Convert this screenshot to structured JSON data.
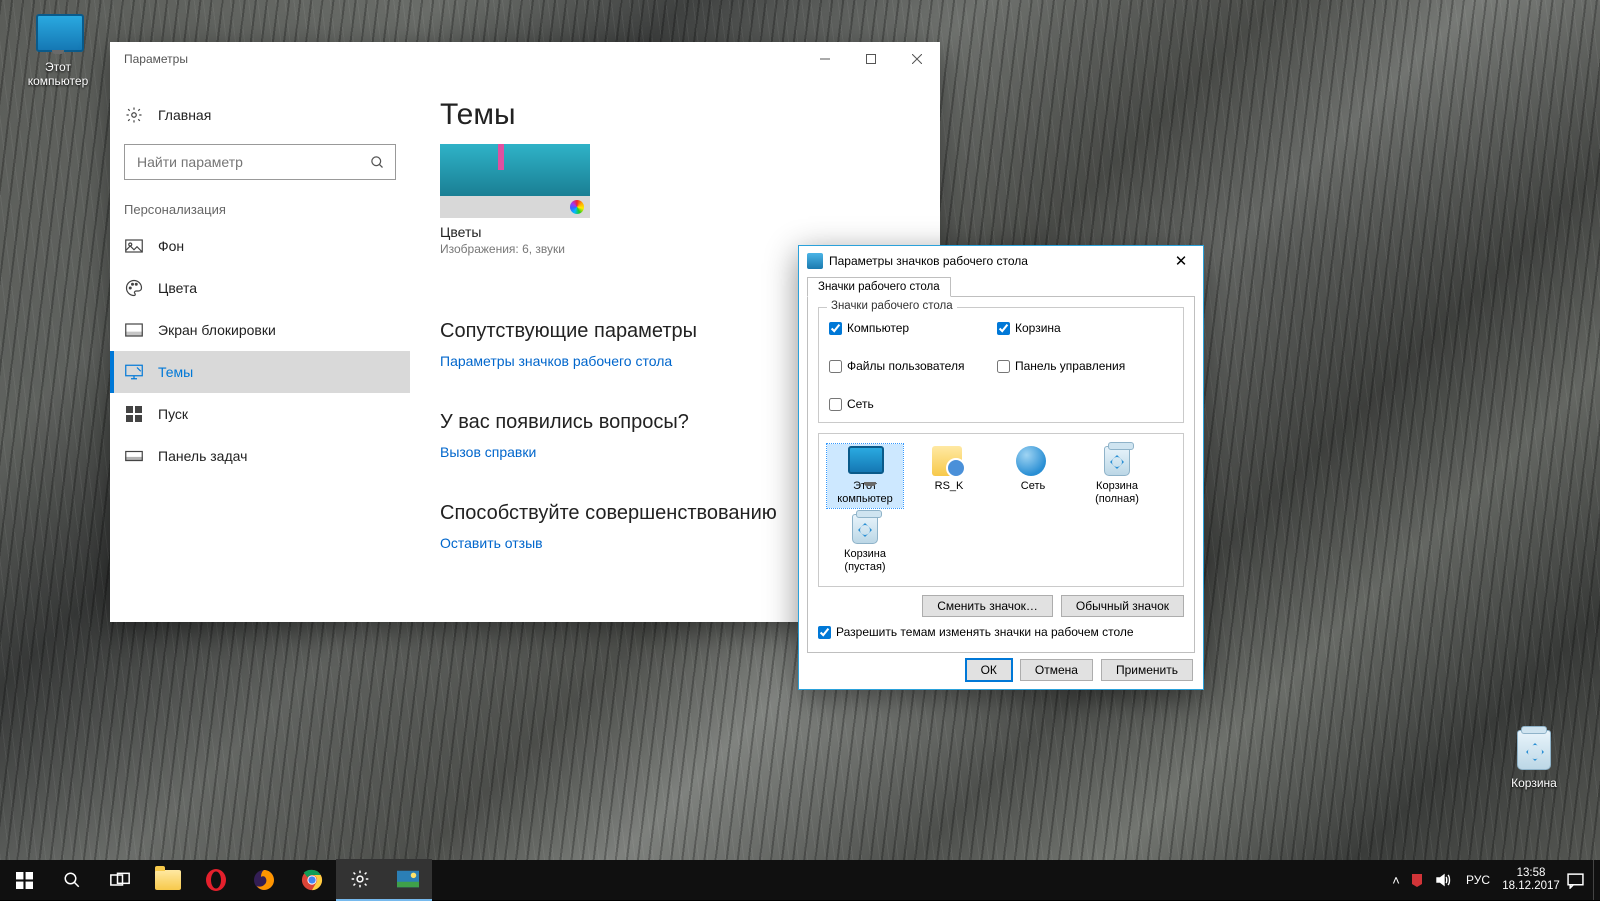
{
  "desktop": {
    "icons": {
      "this_pc": "Этот компьютер",
      "recycle": "Корзина"
    }
  },
  "settings": {
    "title": "Параметры",
    "home": "Главная",
    "search_placeholder": "Найти параметр",
    "section": "Персонализация",
    "nav": {
      "background": "Фон",
      "colors": "Цвета",
      "lockscreen": "Экран блокировки",
      "themes": "Темы",
      "start": "Пуск",
      "taskbar": "Панель задач"
    },
    "main": {
      "heading": "Темы",
      "theme_name": "Цветы",
      "theme_sub": "Изображения: 6, звуки",
      "related_heading": "Сопутствующие параметры",
      "related_link": "Параметры значков рабочего стола",
      "help_heading": "У вас появились вопросы?",
      "help_link": "Вызов справки",
      "feedback_heading": "Способствуйте совершенствованию",
      "feedback_link": "Оставить отзыв"
    }
  },
  "dialog": {
    "title": "Параметры значков рабочего стола",
    "tab": "Значки рабочего стола",
    "group_title": "Значки рабочего стола",
    "checks": {
      "computer": "Компьютер",
      "recycle": "Корзина",
      "userfiles": "Файлы пользователя",
      "controlpanel": "Панель управления",
      "network": "Сеть"
    },
    "icons": {
      "this_pc": "Этот компьютер",
      "user": "RS_K",
      "network": "Сеть",
      "bin_full": "Корзина (полная)",
      "bin_empty": "Корзина (пустая)"
    },
    "btn_change": "Сменить значок…",
    "btn_default": "Обычный значок",
    "allow_themes": "Разрешить темам изменять значки на рабочем столе",
    "ok": "ОК",
    "cancel": "Отмена",
    "apply": "Применить"
  },
  "taskbar": {
    "lang": "РУС",
    "time": "13:58",
    "date": "18.12.2017"
  }
}
